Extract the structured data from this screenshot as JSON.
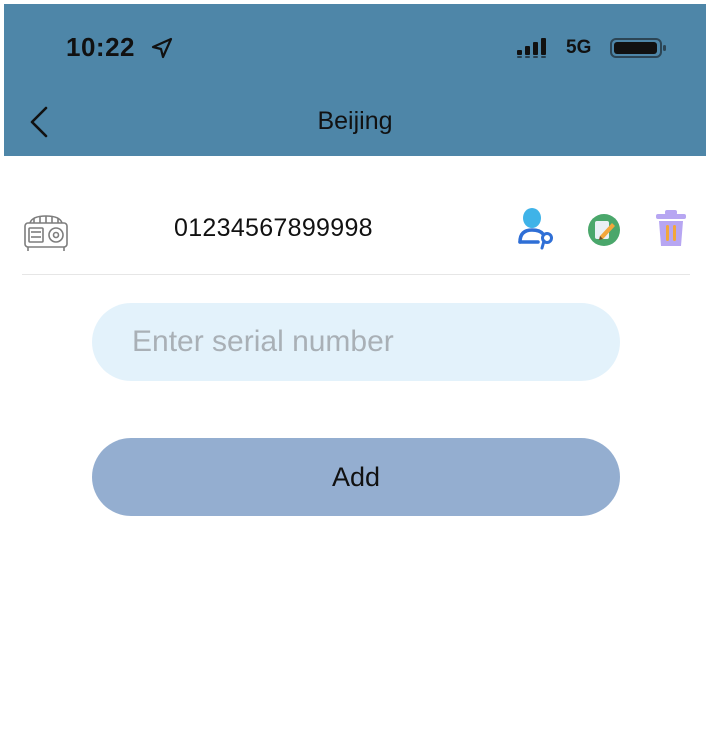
{
  "status_bar": {
    "time": "10:22",
    "network": "5G",
    "icons": [
      "location-arrow-icon",
      "signal-bars-icon",
      "battery-icon"
    ]
  },
  "header": {
    "back_icon": "chevron-left-icon",
    "title": "Beijing"
  },
  "device_row": {
    "device_icon": "device-unit-icon",
    "serial": "01234567899998",
    "actions": [
      {
        "name": "assign-user-icon",
        "color": "#2f6fd6"
      },
      {
        "name": "edit-icon",
        "color": "#4aa76b"
      },
      {
        "name": "trash-icon",
        "color": "#b7a6f2"
      }
    ]
  },
  "serial_input": {
    "placeholder": "Enter serial number",
    "value": ""
  },
  "add_button": {
    "label": "Add"
  },
  "colors": {
    "header_bg": "#4e86a8",
    "input_bg": "#e3f2fb",
    "button_bg": "#94aed0"
  }
}
